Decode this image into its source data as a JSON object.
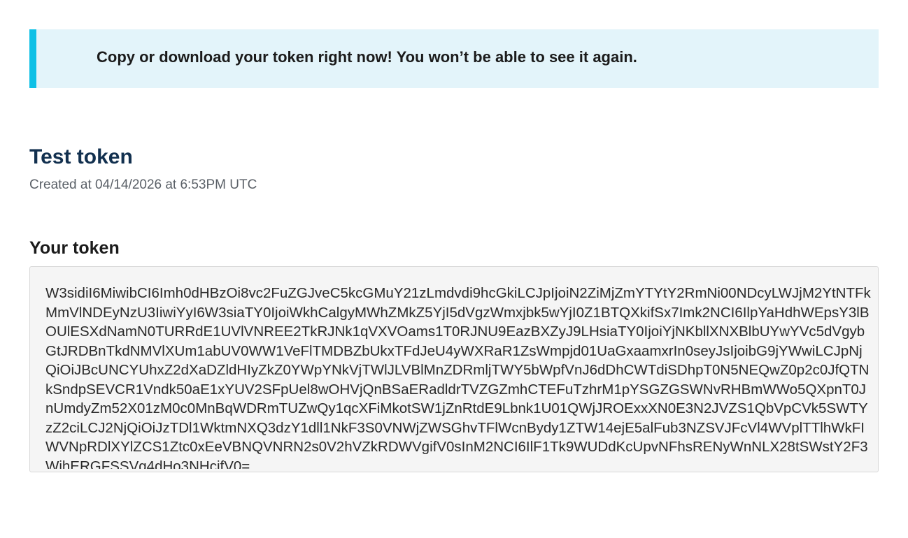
{
  "notice": {
    "message": "Copy or download your token right now! You won’t be able to see it again."
  },
  "token": {
    "name": "Test token",
    "created_text": "Created at 04/14/2026 at 6:53PM UTC",
    "section_label": "Your token",
    "value": "W3sidiI6MiwibCI6Imh0dHBzOi8vc2FuZGJveC5kcGMuY21zLmdvdi9hcGkiLCJpIjoiN2ZiMjZmYTYtY2RmNi00NDcyLWJjM2YtNTFkMmVlNDEyNzU3IiwiYyI6W3siaTY0IjoiWkhCalgyMWhZMkZ5YjI5dVgzWmxjbk5wYjI0Z1BTQXkifSx7Imk2NCI6IlpYaHdhWEpsY3lBOUlESXdNamN0TURRdE1UVlVNREE2TkRJNk1qVXVOams1T0RJNU9EazBXZyJ9LHsiaTY0IjoiYjNKbllXNXBlbUYwYVc5dVgybGtJRDBnTkdNMVlXUm1abUV0WW1VeFlTMDBZbUkxTFdJeU4yWXRaR1ZsWmpjd01UaGxaamxrIn0seyJsIjoibG9jYWwiLCJpNjQiOiJBcUNCYUhxZ2dXaDZldHIyZkZ0YWpYNkVjTWlJLVBlMnZDRmljTWY5bWpfVnJ6dDhCWTdiSDhpT0N5NEQwZ0p2c0JfQTNkSndpSEVCR1Vndk50aE1xYUV2SFpUel8wOHVjQnBSaERadldrTVZGZmhCTEFuTzhrM1pYSGZGSWNvRHBmWWo5QXpnT0JnUmdyZm52X01zM0c0MnBqWDRmTUZwQy1qcXFiMkotSW1jZnRtdE9Lbnk1U01QWjJROExxXN0E3N2JVZS1QbVpCVk5SWTYzZ2ciLCJ2NjQiOiJzTDl1WktmNXQ3dzY1dll1NkF3S0VNWjZWSGhvTFlWcnBydy1ZTW14ejE5alFub3NZSVJFcVl4WVplTTlhWkFIWVNpRDlXYlZCS1Ztc0xEeVBNQVNRN2s0V2hVZkRDWVgifV0sInM2NCI6IlF1Tk9WUDdKcUpvNFhsRENyWnNLX28tSWstY2F3WjhERGFSSVg4dHo3NHcifV0="
  }
}
